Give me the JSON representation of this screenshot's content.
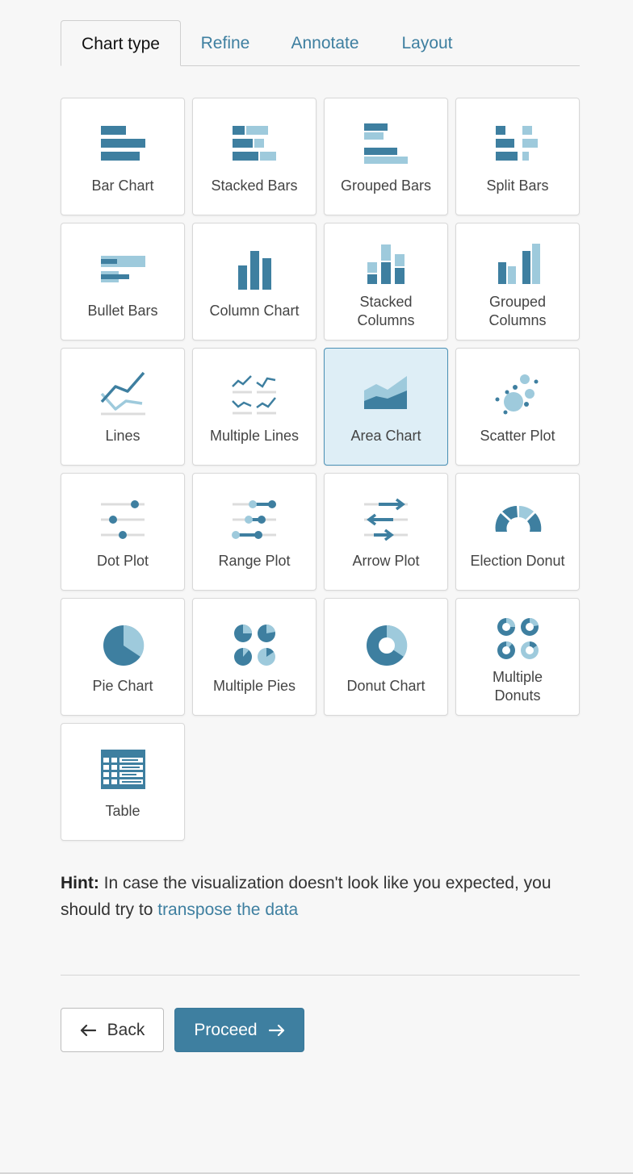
{
  "tabs": [
    {
      "label": "Chart type",
      "active": true
    },
    {
      "label": "Refine",
      "active": false
    },
    {
      "label": "Annotate",
      "active": false
    },
    {
      "label": "Layout",
      "active": false
    }
  ],
  "chart_types": [
    {
      "label": "Bar Chart",
      "icon": "bar-chart-icon"
    },
    {
      "label": "Stacked Bars",
      "icon": "stacked-bars-icon"
    },
    {
      "label": "Grouped Bars",
      "icon": "grouped-bars-icon"
    },
    {
      "label": "Split Bars",
      "icon": "split-bars-icon"
    },
    {
      "label": "Bullet Bars",
      "icon": "bullet-bars-icon"
    },
    {
      "label": "Column Chart",
      "icon": "column-chart-icon"
    },
    {
      "label": "Stacked Columns",
      "icon": "stacked-columns-icon"
    },
    {
      "label": "Grouped Columns",
      "icon": "grouped-columns-icon"
    },
    {
      "label": "Lines",
      "icon": "lines-icon"
    },
    {
      "label": "Multiple Lines",
      "icon": "multiple-lines-icon"
    },
    {
      "label": "Area Chart",
      "icon": "area-chart-icon",
      "selected": true
    },
    {
      "label": "Scatter Plot",
      "icon": "scatter-plot-icon"
    },
    {
      "label": "Dot Plot",
      "icon": "dot-plot-icon"
    },
    {
      "label": "Range Plot",
      "icon": "range-plot-icon"
    },
    {
      "label": "Arrow Plot",
      "icon": "arrow-plot-icon"
    },
    {
      "label": "Election Donut",
      "icon": "election-donut-icon"
    },
    {
      "label": "Pie Chart",
      "icon": "pie-chart-icon"
    },
    {
      "label": "Multiple Pies",
      "icon": "multiple-pies-icon"
    },
    {
      "label": "Donut Chart",
      "icon": "donut-chart-icon"
    },
    {
      "label": "Multiple Donuts",
      "icon": "multiple-donuts-icon"
    },
    {
      "label": "Table",
      "icon": "table-icon"
    }
  ],
  "hint": {
    "prefix": "Hint:",
    "text": " In case the visualization doesn't look like you expected, you should try to ",
    "link": "transpose the data"
  },
  "buttons": {
    "back": "Back",
    "proceed": "Proceed"
  },
  "colors": {
    "accent": "#3e7fa0",
    "icon_dark": "#3e7fa0",
    "icon_light": "#9ecadc",
    "selected_bg": "#deeef6"
  }
}
